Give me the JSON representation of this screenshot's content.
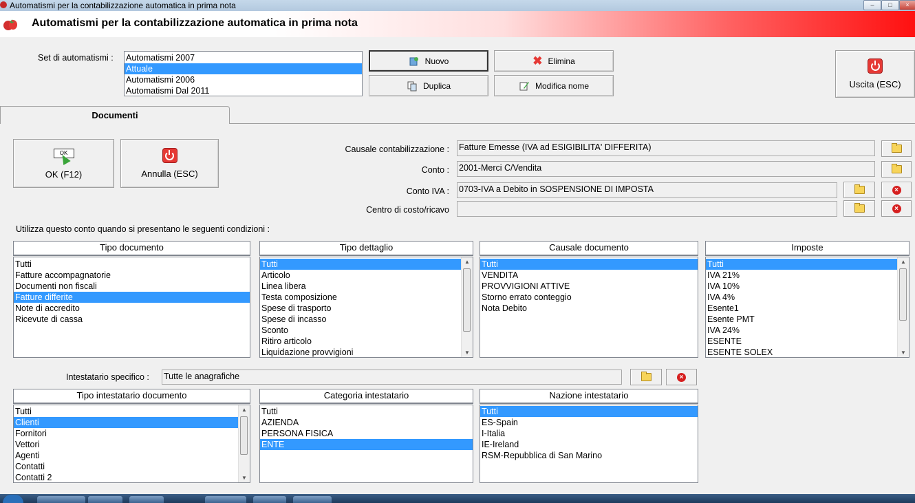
{
  "window": {
    "title": "Automatismi per la contabilizzazione automatica in prima nota",
    "controls": [
      "minimize-icon",
      "maximize-icon",
      "close-icon"
    ]
  },
  "header": {
    "title": "Automatismi per la contabilizzazione automatica in prima nota"
  },
  "set": {
    "label": "Set di automatismi :",
    "items": [
      "Automatismi 2007",
      "Attuale",
      "Automatismi 2006",
      "Automatismi Dal 2011"
    ],
    "selected_index": 1
  },
  "toolbar": {
    "nuovo": "Nuovo",
    "elimina": "Elimina",
    "duplica": "Duplica",
    "modifica_nome": "Modifica nome",
    "uscita": "Uscita (ESC)"
  },
  "tabs": [
    {
      "label": "Documenti"
    }
  ],
  "actions": {
    "ok": "OK (F12)",
    "ok_icon_text": "OK",
    "annulla": "Annulla (ESC)"
  },
  "fields": {
    "causale_label": "Causale contabilizzazione :",
    "causale_value": "Fatture Emesse (IVA ad ESIGIBILITA' DIFFERITA)",
    "conto_label": "Conto :",
    "conto_value": "2001-Merci C/Vendita",
    "conto_iva_label": "Conto IVA :",
    "conto_iva_value": "0703-IVA a Debito in SOSPENSIONE DI IMPOSTA",
    "centro_label": "Centro di costo/ricavo",
    "centro_value": ""
  },
  "conditions_label": "Utilizza questo conto quando si presentano le seguenti condizioni :",
  "lists": {
    "tipo_documento": {
      "header": "Tipo documento",
      "items": [
        "Tutti",
        "Fatture accompagnatorie",
        "Documenti non fiscali",
        "Fatture differite",
        "Note di accredito",
        "Ricevute di cassa"
      ],
      "selected_index": 3
    },
    "tipo_dettaglio": {
      "header": "Tipo dettaglio",
      "items": [
        "Tutti",
        "Articolo",
        "Linea libera",
        "Testa composizione",
        "Spese di trasporto",
        "Spese di incasso",
        "Sconto",
        "Ritiro articolo",
        "Liquidazione provvigioni"
      ],
      "selected_index": 0
    },
    "causale_documento": {
      "header": "Causale documento",
      "items": [
        "Tutti",
        "VENDITA",
        "PROVVIGIONI ATTIVE",
        "Storno errato conteggio",
        "Nota Debito"
      ],
      "selected_index": 0
    },
    "imposte": {
      "header": "Imposte",
      "items": [
        "Tutti",
        "IVA 21%",
        "IVA 10%",
        "IVA 4%",
        "Esente1",
        "Esente PMT",
        "IVA 24%",
        "ESENTE",
        "ESENTE SOLEX"
      ],
      "selected_index": 0
    },
    "tipo_intestatario": {
      "header": "Tipo intestatario documento",
      "items": [
        "Tutti",
        "Clienti",
        "Fornitori",
        "Vettori",
        "Agenti",
        "Contatti",
        "Contatti 2"
      ],
      "selected_index": 1
    },
    "categoria_intestatario": {
      "header": "Categoria intestatario",
      "items": [
        "Tutti",
        "AZIENDA",
        "PERSONA FISICA",
        "ENTE"
      ],
      "selected_index": 3
    },
    "nazione_intestatario": {
      "header": "Nazione intestatario",
      "items": [
        "Tutti",
        "ES-Spain",
        "I-Italia",
        "IE-Ireland",
        "RSM-Repubblica di San Marino"
      ],
      "selected_index": 0
    }
  },
  "intestatario": {
    "label": "Intestatario specifico :",
    "value": "Tutte le anagrafiche"
  },
  "colors": {
    "selection": "#3399ff",
    "header_gradient_end": "#ff1010"
  }
}
